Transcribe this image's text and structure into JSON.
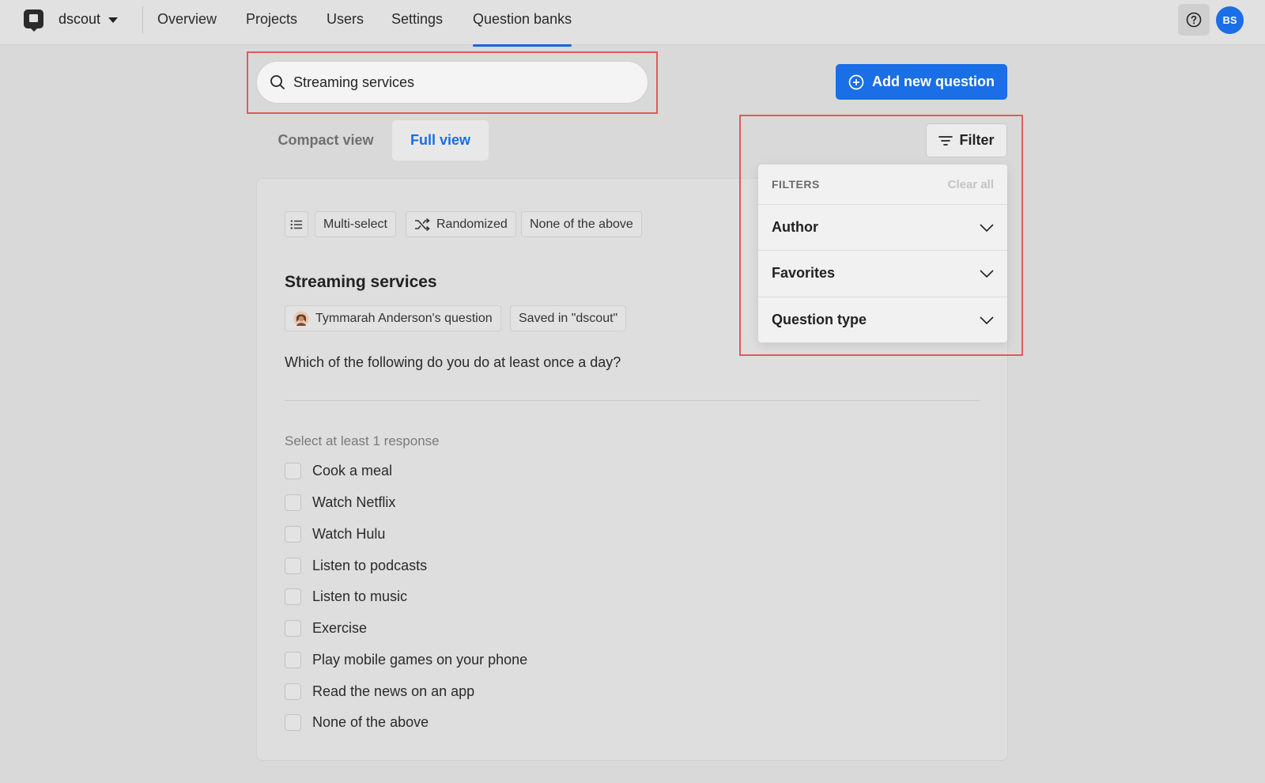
{
  "nav": {
    "org": "dscout",
    "links": [
      "Overview",
      "Projects",
      "Users",
      "Settings",
      "Question banks"
    ],
    "active": "Question banks",
    "avatar_initials": "BS"
  },
  "search": {
    "value": "Streaming services"
  },
  "add_button": {
    "label": "Add new question"
  },
  "view_tabs": {
    "compact": "Compact view",
    "full": "Full view",
    "active": "Full view"
  },
  "question": {
    "chips": [
      "Multi-select",
      "Randomized",
      "None of the above"
    ],
    "title": "Streaming services",
    "author": "Tymmarah Anderson's question",
    "saved_in": "Saved in \"dscout\"",
    "text": "Which of the following do you do at least once a day?",
    "hint": "Select at least 1 response",
    "options": [
      "Cook a meal",
      "Watch Netflix",
      "Watch Hulu",
      "Listen to podcasts",
      "Listen to music",
      "Exercise",
      "Play mobile games on your phone",
      "Read the news on an app",
      "None of the above"
    ]
  },
  "filter": {
    "button": "Filter",
    "heading": "FILTERS",
    "clear": "Clear all",
    "rows": [
      "Author",
      "Favorites",
      "Question type"
    ]
  },
  "colors": {
    "accent": "#1a6ee6",
    "highlight": "#e05a5a"
  }
}
